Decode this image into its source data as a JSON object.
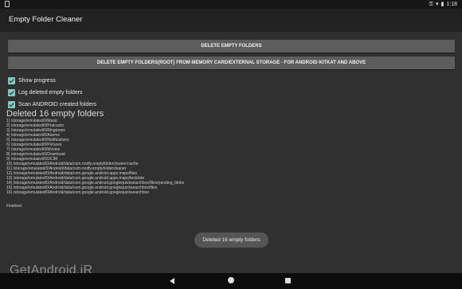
{
  "status_bar": {
    "time": "1:18"
  },
  "app": {
    "title": "Empty Folder Cleaner"
  },
  "buttons": {
    "delete_empty": "DELETE  EMPTY  FOLDERS",
    "delete_root": "DELETE EMPTY FOLDERS(ROOT) FROM MEMORY CARD/EXTERNAL STORAGE - FOR ANDROID KITKAT AND ABOVE"
  },
  "options": [
    {
      "label": "Show progress",
      "checked": true
    },
    {
      "label": "Log deleted empty folders",
      "checked": true
    },
    {
      "label": "Scan ANDROID created folders",
      "checked": true
    }
  ],
  "result": {
    "title": "Deleted 16 empty folders",
    "log": [
      "1) /storage/emulated/0/Music",
      "2) /storage/emulated/0/Podcasts",
      "3) /storage/emulated/0/Ringtones",
      "4) /storage/emulated/0/Alarms",
      "5) /storage/emulated/0/Notifications",
      "6) /storage/emulated/0/Pictures",
      "7) /storage/emulated/0/Movies",
      "8) /storage/emulated/0/Download",
      "9) /storage/emulated/0/DCIM",
      "10) /storage/emulated/0/Android/data/com.rootfy.emptyfoldercleaner/cache",
      "11) /storage/emulated/0/Android/data/com.rootfy.emptyfoldercleaner",
      "12) /storage/emulated/0/Android/data/com.google.android.apps.maps/files",
      "13) /storage/emulated/0/Android/data/com.google.android.apps.maps/testdata",
      "14) /storage/emulated/0/Android/data/com.google.android.googlequicksearchbox/files/pending_blobs",
      "15) /storage/emulated/0/Android/data/com.google.android.googlequicksearchbox/files",
      "16) /storage/emulated/0/Android/data/com.google.android.googlequicksearchbox"
    ],
    "finished": "Finished"
  },
  "toast": "Deleted 16 empty folders",
  "watermark": "GetAndroid.iR",
  "icons": {
    "status_left": "notification-icon",
    "status_right": [
      "key-icon",
      "wifi-icon",
      "battery-icon"
    ],
    "nav": [
      "back-icon",
      "home-icon",
      "recents-icon"
    ]
  },
  "colors": {
    "background": "#303030",
    "action_bar": "#212121",
    "button": "#5d5d5d",
    "checkbox_accent": "#80cbc4"
  }
}
